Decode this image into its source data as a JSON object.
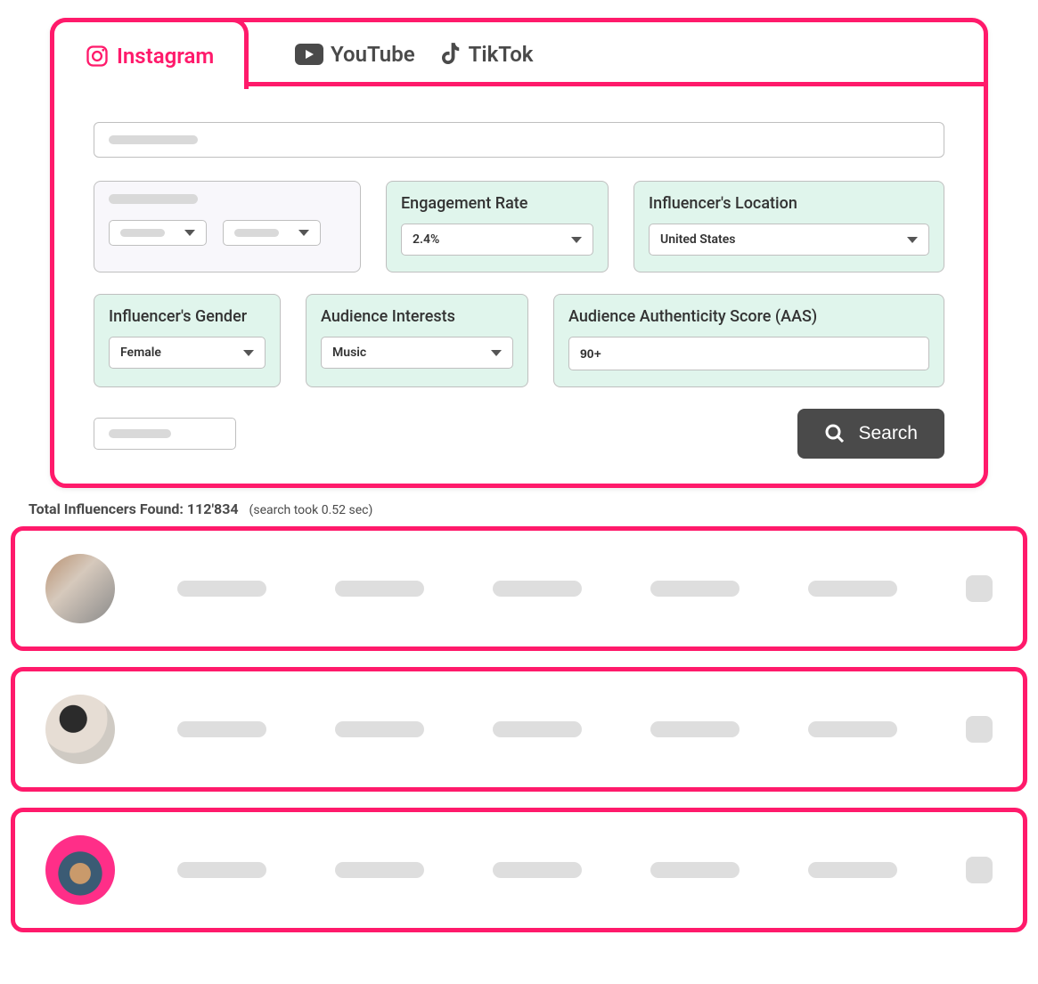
{
  "tabs": {
    "instagram": "Instagram",
    "youtube": "YouTube",
    "tiktok": "TikTok"
  },
  "filters": {
    "engagement_rate": {
      "label": "Engagement Rate",
      "value": "2.4%"
    },
    "influencer_location": {
      "label": "Influencer's Location",
      "value": "United States"
    },
    "influencer_gender": {
      "label": "Influencer's Gender",
      "value": "Female"
    },
    "audience_interests": {
      "label": "Audience Interests",
      "value": "Music"
    },
    "aas": {
      "label": "Audience Authenticity Score (AAS)",
      "value": "90+"
    }
  },
  "search_button": "Search",
  "results": {
    "label": "Total Influencers Found:",
    "count": "112'834",
    "timing": "(search took 0.52 sec)"
  }
}
